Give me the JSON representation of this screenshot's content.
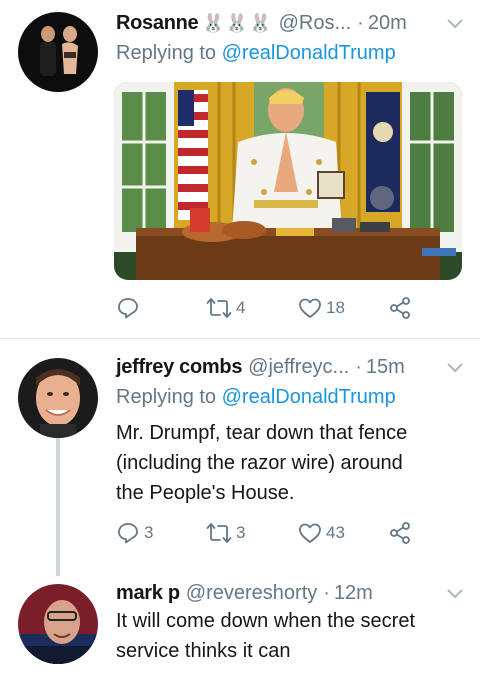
{
  "tweets": [
    {
      "name": "Rosanne",
      "emoji": "🐰🐰🐰",
      "handle": "@Ros...",
      "time": "20m",
      "replying_label": "Replying to",
      "replying_to": "@realDonaldTrump",
      "text": "",
      "has_media": true,
      "replies": "",
      "retweets": "4",
      "likes": "18"
    },
    {
      "name": "jeffrey combs",
      "handle": "@jeffreyc...",
      "time": "15m",
      "replying_label": "Replying to",
      "replying_to": "@realDonaldTrump",
      "text_lines": [
        "Mr. Drumpf, tear down that fence",
        "(including the razor wire) around",
        "the People's House."
      ],
      "replies": "3",
      "retweets": "3",
      "likes": "43"
    },
    {
      "name": "mark p",
      "handle": "@revereshorty",
      "time": "12m",
      "text_lines": [
        "It will come down when the secret",
        "service thinks it can"
      ]
    }
  ],
  "colors": {
    "link": "#1b95e0",
    "secondary": "#657786",
    "divider": "#e1e8ed",
    "thread": "#ccd6dd"
  }
}
